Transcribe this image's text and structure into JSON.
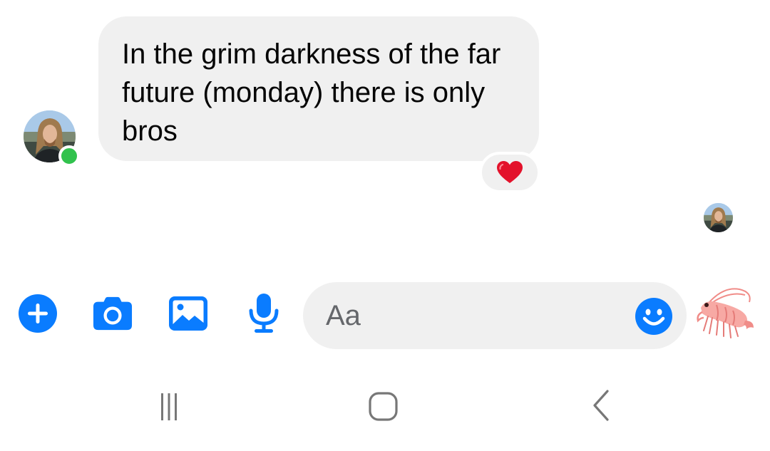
{
  "conversation": {
    "messages": [
      {
        "sender": "contact",
        "text": "In the grim darkness of the far future (monday) there is only bros",
        "reaction": "heart-emoji",
        "sender_online": true
      }
    ],
    "seen_indicator": "avatar"
  },
  "composer": {
    "input_placeholder": "Aa",
    "input_value": "",
    "tools": [
      "plus-icon",
      "camera-icon",
      "gallery-icon",
      "microphone-icon"
    ],
    "emoji_icon": "smiley-icon",
    "quick_reaction": "shrimp-emoji"
  },
  "navigation_bar": {
    "buttons": [
      "recents-icon",
      "home-icon",
      "back-icon"
    ]
  },
  "colors": {
    "accent": "#0a7cff",
    "bubble": "#f0f0f0",
    "online": "#31c24d",
    "reaction_heart": "#e3122b",
    "nav_icons": "#777777"
  }
}
